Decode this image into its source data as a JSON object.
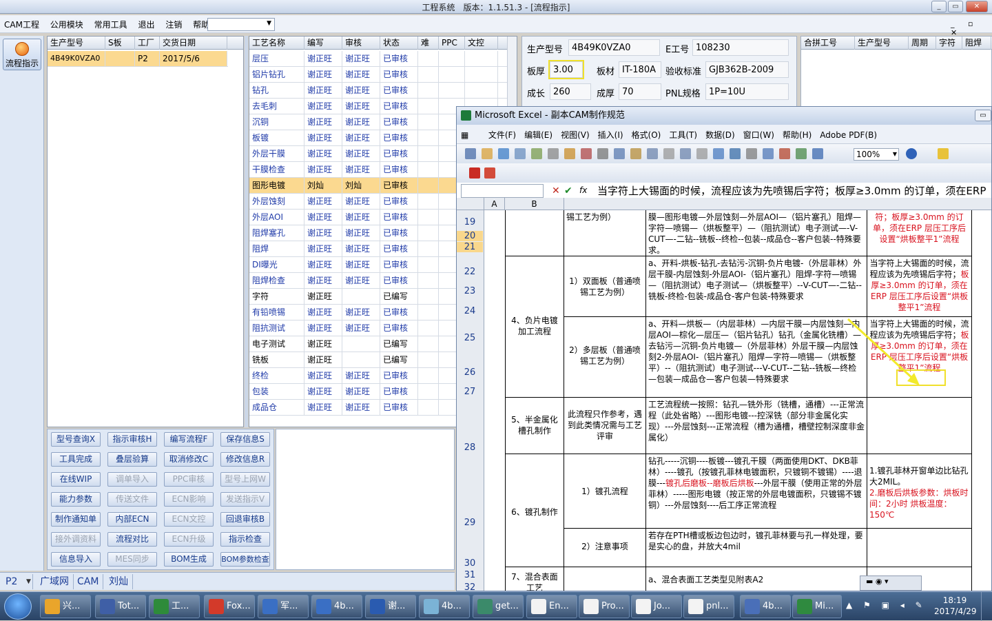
{
  "window": {
    "title": "工程系统　版本：1.1.51.3 - [流程指示]"
  },
  "menu": {
    "items": [
      "CAM工程",
      "公用模块",
      "常用工具",
      "退出",
      "注销",
      "帮助"
    ]
  },
  "left": {
    "button": "流程指示"
  },
  "list1": {
    "headers": [
      "生产型号",
      "S板",
      "工厂",
      "交货日期"
    ],
    "row": [
      "4B49K0VZA0",
      "",
      "P2",
      "2017/5/6"
    ]
  },
  "process": {
    "headers": [
      "工艺名称",
      "编写",
      "审核",
      "状态",
      "难",
      "PPC",
      "文控"
    ],
    "rows": [
      [
        "层压",
        "谢正旺",
        "谢正旺",
        "已审核"
      ],
      [
        "铝片钻孔",
        "谢正旺",
        "谢正旺",
        "已审核"
      ],
      [
        "钻孔",
        "谢正旺",
        "谢正旺",
        "已审核"
      ],
      [
        "去毛刺",
        "谢正旺",
        "谢正旺",
        "已审核"
      ],
      [
        "沉铜",
        "谢正旺",
        "谢正旺",
        "已审核"
      ],
      [
        "板镀",
        "谢正旺",
        "谢正旺",
        "已审核"
      ],
      [
        "外层干膜",
        "谢正旺",
        "谢正旺",
        "已审核"
      ],
      [
        "干膜检查",
        "谢正旺",
        "谢正旺",
        "已审核"
      ],
      [
        "图形电镀",
        "刘灿",
        "刘灿",
        "已审核"
      ],
      [
        "外层蚀刻",
        "谢正旺",
        "谢正旺",
        "已审核"
      ],
      [
        "外层AOI",
        "谢正旺",
        "谢正旺",
        "已审核"
      ],
      [
        "阻焊塞孔",
        "谢正旺",
        "谢正旺",
        "已审核"
      ],
      [
        "阻焊",
        "谢正旺",
        "谢正旺",
        "已审核"
      ],
      [
        "DI曝光",
        "谢正旺",
        "谢正旺",
        "已审核"
      ],
      [
        "阻焊检查",
        "谢正旺",
        "谢正旺",
        "已审核"
      ],
      [
        "字符",
        "谢正旺",
        "",
        "已编写"
      ],
      [
        "有铅喷锡",
        "谢正旺",
        "谢正旺",
        "已审核"
      ],
      [
        "阻抗测试",
        "谢正旺",
        "谢正旺",
        "已审核"
      ],
      [
        "电子测试",
        "谢正旺",
        "",
        "已编写"
      ],
      [
        "铣板",
        "谢正旺",
        "",
        "已编写"
      ],
      [
        "终检",
        "谢正旺",
        "谢正旺",
        "已审核"
      ],
      [
        "包装",
        "谢正旺",
        "谢正旺",
        "已审核"
      ],
      [
        "成品仓",
        "谢正旺",
        "谢正旺",
        "已审核"
      ]
    ]
  },
  "buttons": [
    [
      "型号查询X",
      "指示审核H",
      "编写流程F",
      "保存信息S"
    ],
    [
      "工具完成",
      "叠层验算",
      "取消修改C",
      "修改信息R"
    ],
    [
      "在线WIP",
      "调单导入",
      "PPC审核",
      "型号上网W"
    ],
    [
      "能力参数",
      "传送文件",
      "ECN影响",
      "发送指示V"
    ],
    [
      "制作通知单",
      "内部ECN",
      "ECN文控",
      "回退审核B"
    ],
    [
      "接外调资料",
      "流程对比",
      "ECN升级",
      "指示检查"
    ],
    [
      "信息导入",
      "MES同步",
      "BOM生成",
      "BOM参数检查"
    ]
  ],
  "info": {
    "model_label": "生产型号",
    "model": "4B49K0VZA0",
    "eno_label": "E工号",
    "eno": "108230",
    "thick_label": "板厚",
    "thick": "3.00",
    "material_label": "板材",
    "material": "IT-180A",
    "std_label": "验收标准",
    "std": "GJB362B-2009",
    "grow_label": "成长",
    "grow": "260",
    "thick2_label": "成厚",
    "thick2": "70",
    "pnl_label": "PNL规格",
    "pnl": "1P=10U"
  },
  "rightgrid": {
    "headers": [
      "合拼工号",
      "生产型号",
      "周期",
      "字符",
      "阻焊"
    ]
  },
  "status": {
    "items": [
      "P2",
      "广域网",
      "CAM",
      "刘灿"
    ]
  },
  "excel": {
    "title": "Microsoft Excel - 副本CAM制作规范",
    "menu": [
      "文件(F)",
      "编辑(E)",
      "视图(V)",
      "插入(I)",
      "格式(O)",
      "工具(T)",
      "数据(D)",
      "窗口(W)",
      "帮助(H)",
      "Adobe PDF(B)"
    ],
    "zoom": "100%",
    "formula": "当字符上大锡面的时候，流程应该为先喷锡后字符；板厚≥3.0mm 的订单，须在ERP 层压工序后设置“烘板整平1”流程",
    "cols": [
      "A",
      "B"
    ],
    "rows": [
      "19",
      "20",
      "21",
      "22",
      "23",
      "24",
      "25",
      "26",
      "27",
      "28",
      "29",
      "30",
      "31",
      "32"
    ],
    "c_top_left": "锡工艺为例）",
    "c_top_mid": "膜—图形电镀—外层蚀刻—外层AOI—（铝片塞孔）阻焊—字符—喷锡—（烘板整平）—（阻抗测试）电子测试—-V-CUT—-二钻--铣板--终检--包装--成品仓--客户包装--特殊要求。",
    "c_top_note": "符；板厚≥3.0mm 的订单，须在ERP 层压工序后设置“烘板整平1”流程",
    "sec4": "4、负片电镀加工流程",
    "r1_name": "1）双面板（普通喷锡工艺为例）",
    "r1_flow": "a、开料-烘板-钻孔-去钻污-沉铜-负片电镀-（外层菲林）外层干膜-内层蚀刻-外层AOI-（铝片塞孔）阻焊-字符—喷锡—（阻抗测试）电子测试—（烘板整平）--V-CUT—-二钻--铣板-终检-包装-成品仓-客户包装-特殊要求",
    "r1_note_a": "当字符上大锡面的时候，流程应该为先喷锡后字符；",
    "r1_note_b": "板厚≥3.0mm 的订单，须在ERP 层压工序后设置“烘板整平1”流程",
    "r2_name": "2）多层板（普通喷锡工艺为例）",
    "r2_flow": "a、开料—烘板—（内层菲林）—内层干膜—内层蚀刻—内层AOI—棕化—层压—（铝片钻孔）钻孔（金属化铣槽）—去钻污—沉铜-负片电镀—（外层菲林）外层干膜—内层蚀刻2-外层AOI-（铝片塞孔）阻焊—字符—喷锡—（烘板整平）--（阻抗测试）电子测试---V-CUT--二钻--铣板—终检—包装—成品仓—客户包装—特殊要求",
    "r2_note_a": "当字符上大锡面的时候，流程应该为先喷锡后字符；",
    "r2_note_b": "板厚≥3.0mm 的订单，须在ERP 层压工序后设置“烘板整平1”流程",
    "sec5": "5、半金属化槽孔制作",
    "r5_name": "此流程只作参考，遇到此类情况需与工艺评审",
    "r5_flow": "工艺流程统一按照：钻孔—铣外形（铣槽，通槽）---正常流程（此处省略）---图形电镀---控深铣（部分非金属化实现）---外层蚀刻---正常流程（槽为通槽，槽壁控制深度非金属化）",
    "sec6": "6、镀孔制作",
    "r6_name": "1）镀孔流程",
    "r6_flow_a": "钻孔-----沉铜----板镀---镀孔干膜（两面使用DKT、DKB菲林）----镀孔（按镀孔菲林电镀面积，只镀铜不镀锡）----退膜---",
    "r6_flow_b": "镀孔后磨板--磨板后烘板",
    "r6_flow_c": "---外层干膜（使用正常的外层菲林）-----图形电镀（按正常的外层电镀面积，只镀锡不镀铜）---外层蚀刻----后工序正常流程",
    "r6_note_a": "1.镀孔菲林开窗单边比钻孔大2MIL。",
    "r6_note_b": "2.磨板后烘板参数：烘板时间：2小时 烘板温度：150℃",
    "r7_name": "2）注意事项",
    "r7_flow": "若存在PTH槽或板边包边时，镀孔菲林要与孔一样处理，要是实心的盘，并放大4mil",
    "sec7": "7、混合表面工艺",
    "r8_flow": "a、混合表面工艺类型见附表A2",
    "r8_note": "\\"
  },
  "taskbar": {
    "items": [
      "兴...",
      "Tot...",
      "工...",
      "Fox...",
      "军...",
      "4b...",
      "谢...",
      "4b...",
      "get...",
      "En...",
      "Pro...",
      "Jo...",
      "pnl...",
      "4b...",
      "Mi..."
    ],
    "time": "18:19",
    "date": "2017/4/29"
  }
}
